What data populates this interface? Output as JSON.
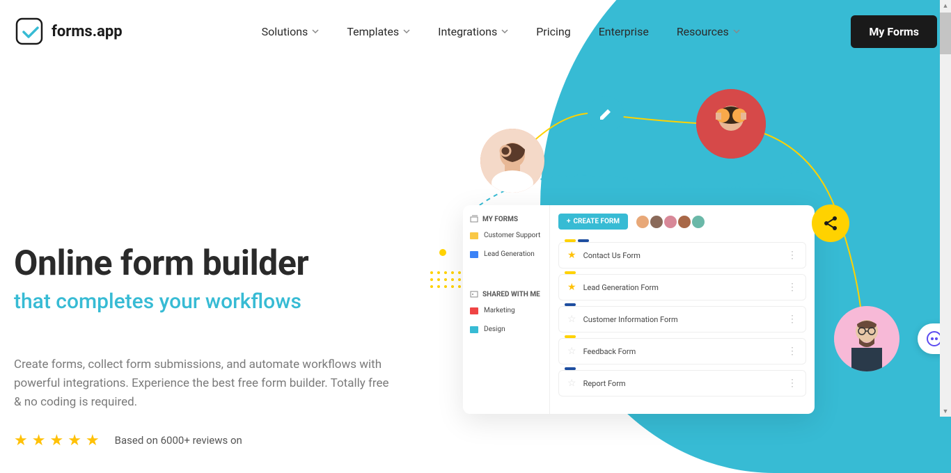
{
  "brand": "forms.app",
  "nav": {
    "items": [
      "Solutions",
      "Templates",
      "Integrations",
      "Pricing",
      "Enterprise",
      "Resources"
    ],
    "has_dropdown": [
      true,
      true,
      true,
      false,
      false,
      true
    ]
  },
  "cta": "My Forms",
  "hero": {
    "title": "Online form builder",
    "subtitle": "that completes your workflows",
    "body": "Create forms, collect form submissions, and automate workflows with powerful integrations. Experience the best free form builder. Totally free & no coding is required.",
    "review_prefix": "Based on 6000+ reviews on"
  },
  "mock": {
    "sidebar": {
      "my_forms": "MY FORMS",
      "shared": "SHARED WITH ME",
      "folders_top": [
        {
          "name": "Customer Support",
          "color": "#f9c846"
        },
        {
          "name": "Lead Generation",
          "color": "#3b82f6"
        }
      ],
      "folders_bottom": [
        {
          "name": "Marketing",
          "color": "#ef4444"
        },
        {
          "name": "Design",
          "color": "#37bbd4"
        }
      ]
    },
    "create": "CREATE FORM",
    "forms": [
      {
        "name": "Contact Us Form",
        "starred": true,
        "chips": [
          "#ffd200",
          "#1e4ea0"
        ]
      },
      {
        "name": "Lead Generation Form",
        "starred": true,
        "chips": [
          "#ffd200"
        ]
      },
      {
        "name": "Customer Information Form",
        "starred": false,
        "chips": [
          "#1e4ea0"
        ]
      },
      {
        "name": "Feedback Form",
        "starred": false,
        "chips": [
          "#ffd200"
        ]
      },
      {
        "name": "Report Form",
        "starred": false,
        "chips": [
          "#1e4ea0"
        ]
      }
    ]
  },
  "colors": {
    "accent": "#37bbd4",
    "yellow": "#ffd200"
  }
}
